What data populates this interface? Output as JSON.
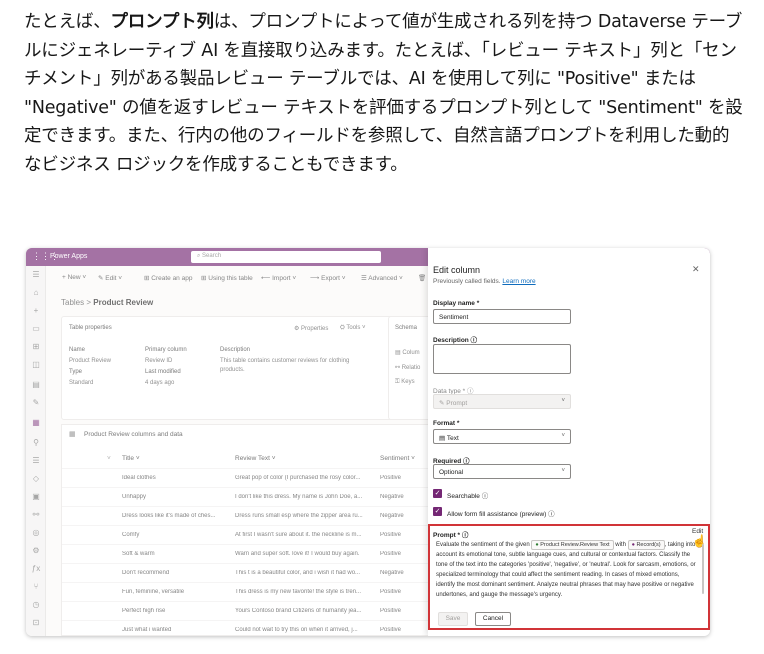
{
  "article": {
    "p1_pre": "たとえば、",
    "p1_bold": "プロンプト列",
    "p1_post": "は、プロンプトによって値が生成される列を持つ Dataverse テーブルにジェネレーティブ AI を直接取り込みます。たとえば、「レビュー テキスト」列と「センチメント」列がある製品レビュー テーブルでは、AI を使用して列に \"Positive\" または \"Negative\" の値を返すレビュー テキストを評価するプロンプト列として \"Sentiment\" を設定できます。また、行内の他のフィールドを参照して、自然言語プロンプトを利用した動的なビジネス ロジックを作成することもできます。"
  },
  "app": {
    "name": "Power Apps",
    "search_placeholder": "Search",
    "brand_color": "#742774"
  },
  "commandbar": {
    "new": "+ New ˅",
    "edit": "✎ Edit ˅",
    "create_app": "⊞ Create an app",
    "using_table": "⊞ Using this table",
    "import": "⟵ Import ˅",
    "export": "⟶ Export ˅",
    "advanced": "☰ Advanced ˅",
    "delete": "🗑 Del"
  },
  "breadcrumb": {
    "root": "Tables",
    "sep": ">",
    "current": "Product Review"
  },
  "table_properties": {
    "title": "Table properties",
    "properties_btn": "⚙ Properties",
    "tools_btn": "⛭ Tools ˅",
    "name_label": "Name",
    "name_value": "Product Review",
    "type_label": "Type",
    "type_value": "Standard",
    "primary_label": "Primary column",
    "primary_value": "Review ID",
    "modified_label": "Last modified",
    "modified_value": "4 days ago",
    "desc_label": "Description",
    "desc_value1": "This table contains customer reviews for clothing",
    "desc_value2": "products."
  },
  "schema": {
    "title": "Schema",
    "columns": "Colum",
    "relations": "Relatio",
    "keys": "Keys"
  },
  "grid": {
    "title": "Product Review columns and data",
    "headers": {
      "title": "Title ˅",
      "review": "Review Text ˅",
      "sentiment": "Sentiment ˅"
    },
    "rows": [
      {
        "title": "Ideal clothes",
        "review": "Great pop of color (I purchased the rosy color...",
        "sentiment": "Positive"
      },
      {
        "title": "Unhappy",
        "review": "I don't like this dress. My name is John Doe, a...",
        "sentiment": "Negative"
      },
      {
        "title": "Dress looks like it's made of ches...",
        "review": "Dress runs small esp where the zipper area ru...",
        "sentiment": "Negative"
      },
      {
        "title": "Comfy",
        "review": "At first I wasn't sure about it. the neckline is m...",
        "sentiment": "Positive"
      },
      {
        "title": "Soft & warm",
        "review": "Warn and super soft. love it! I would buy again.",
        "sentiment": "Positive"
      },
      {
        "title": "Don't recommend",
        "review": "This t is a beautiful color, and i wish it had wo...",
        "sentiment": "Negative"
      },
      {
        "title": "Fun, feminine, versatile",
        "review": "This dress is my new favorite! the style is tren...",
        "sentiment": "Positive"
      },
      {
        "title": "Perfect high rise",
        "review": "Yours Contoso brand Citizens of humanity jea...",
        "sentiment": "Positive"
      },
      {
        "title": "Just what i wanted",
        "review": "Could not wait to try this on when it arrived, j...",
        "sentiment": "Positive"
      }
    ]
  },
  "panel": {
    "title": "Edit column",
    "subtitle": "Previously called fields.",
    "learn_more": "Learn more",
    "display_name_label": "Display name *",
    "display_name_value": "Sentiment",
    "description_label": "Description ⓘ",
    "data_type_label": "Data type * ⓘ",
    "data_type_value": "Prompt",
    "format_label": "Format *",
    "format_value": "Text",
    "required_label": "Required ⓘ",
    "required_value": "Optional",
    "searchable_label": "Searchable ⓘ",
    "form_fill_label": "Allow form fill assistance (preview) ⓘ",
    "prompt_label": "Prompt * ⓘ",
    "edit_link": "Edit",
    "prompt_text_1": "Evaluate the sentiment of the given",
    "chip_review": "Product Review.Review Text",
    "prompt_with": "with",
    "chip_record": "Record(s)",
    "prompt_text_2": ", taking into account its emotional tone, subtle language cues, and cultural or contextual factors. Classify the tone of the text into the categories 'positive', 'negative', or 'neutral'. Look for sarcasm, emotions, or specialized terminology that could affect the sentiment reading. In cases of mixed emotions, identify the most dominant sentiment. Analyze neutral phrases that may have positive or negative undertones, and gauge the message's urgency.",
    "save": "Save",
    "cancel": "Cancel",
    "highlight_color": "#d13438"
  }
}
